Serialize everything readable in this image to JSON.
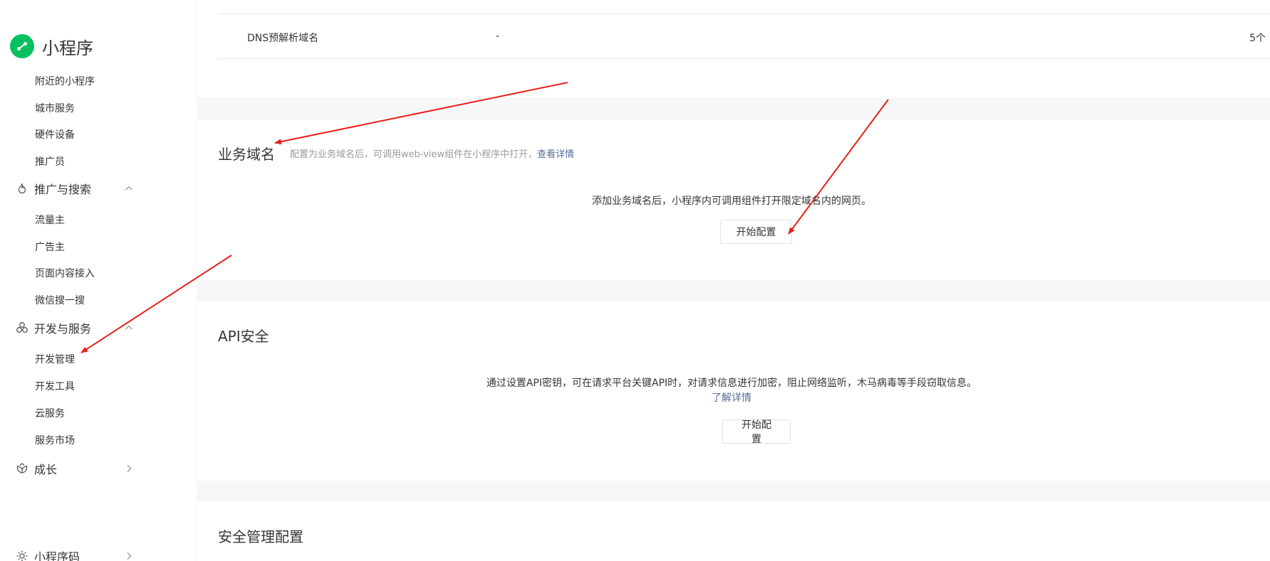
{
  "sidebar": {
    "brand": {
      "title": "小程序",
      "logo_icon": "mini-program-logo-icon",
      "color": "#07c160"
    },
    "items_top": [
      {
        "label": "附近的小程序"
      },
      {
        "label": "城市服务"
      },
      {
        "label": "硬件设备"
      },
      {
        "label": "推广员"
      }
    ],
    "groups": [
      {
        "label": "推广与搜索",
        "icon": "fire-icon",
        "expanded": true,
        "items": [
          {
            "label": "流量主"
          },
          {
            "label": "广告主"
          },
          {
            "label": "页面内容接入"
          },
          {
            "label": "微信搜一搜"
          }
        ]
      },
      {
        "label": "开发与服务",
        "icon": "services-icon",
        "expanded": true,
        "items": [
          {
            "label": "开发管理"
          },
          {
            "label": "开发工具"
          },
          {
            "label": "云服务"
          },
          {
            "label": "服务市场"
          }
        ]
      },
      {
        "label": "成长",
        "icon": "growth-icon",
        "expanded": false
      },
      {
        "label": "小程序码",
        "icon": "sun-icon",
        "expanded": false
      }
    ]
  },
  "dns_section": {
    "row": {
      "name": "DNS预解析域名",
      "value": "-",
      "count": "5个"
    }
  },
  "business_domain": {
    "title": "业务域名",
    "desc": "配置为业务域名后，可调用web-view组件在小程序中打开，",
    "desc_link": "查看详情",
    "body": "添加业务域名后，小程序内可调用组件打开限定域名内的网页。",
    "button": "开始配置"
  },
  "api_security": {
    "title": "API安全",
    "body": "通过设置API密钥，可在请求平台关键API时，对请求信息进行加密，阻止网络监听，木马病毒等手段窃取信息。",
    "link": "了解详情",
    "button": "开始配置"
  },
  "security_config": {
    "title": "安全管理配置"
  },
  "colors": {
    "accent": "#07c160",
    "link": "#576b95",
    "annotation": "#e8201a"
  }
}
